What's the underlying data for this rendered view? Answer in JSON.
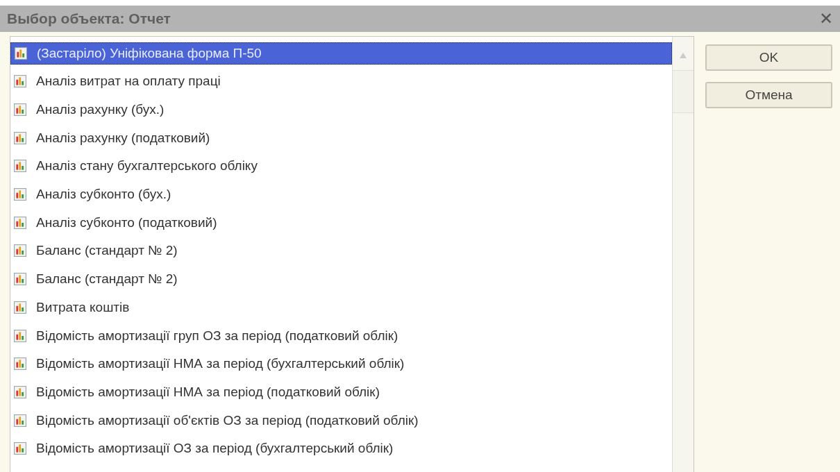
{
  "window": {
    "title": "Выбор объекта: Отчет",
    "close": "✕"
  },
  "list": {
    "items": [
      {
        "label": "(Застаріло) Уніфікована форма П-50",
        "selected": true
      },
      {
        "label": "Аналіз витрат на оплату праці",
        "selected": false
      },
      {
        "label": "Аналіз рахунку (бух.)",
        "selected": false
      },
      {
        "label": "Аналіз рахунку (податковий)",
        "selected": false
      },
      {
        "label": "Аналіз стану бухгалтерського обліку",
        "selected": false
      },
      {
        "label": "Аналіз субконто (бух.)",
        "selected": false
      },
      {
        "label": "Аналіз субконто (податковий)",
        "selected": false
      },
      {
        "label": "Баланс (стандарт № 2)",
        "selected": false
      },
      {
        "label": "Баланс (стандарт № 2)",
        "selected": false
      },
      {
        "label": "Витрата коштів",
        "selected": false
      },
      {
        "label": "Відомість амортизації груп ОЗ за період (податковий облік)",
        "selected": false
      },
      {
        "label": "Відомість амортизації НМА за період (бухгалтерський облік)",
        "selected": false
      },
      {
        "label": "Відомість амортизації НМА за період (податковий облік)",
        "selected": false
      },
      {
        "label": "Відомість амортизації об'єктів ОЗ за період (податковий облік)",
        "selected": false
      },
      {
        "label": "Відомість амортизації ОЗ за період (бухгалтерський облік)",
        "selected": false
      }
    ]
  },
  "buttons": [
    "OK",
    "Отмена"
  ]
}
